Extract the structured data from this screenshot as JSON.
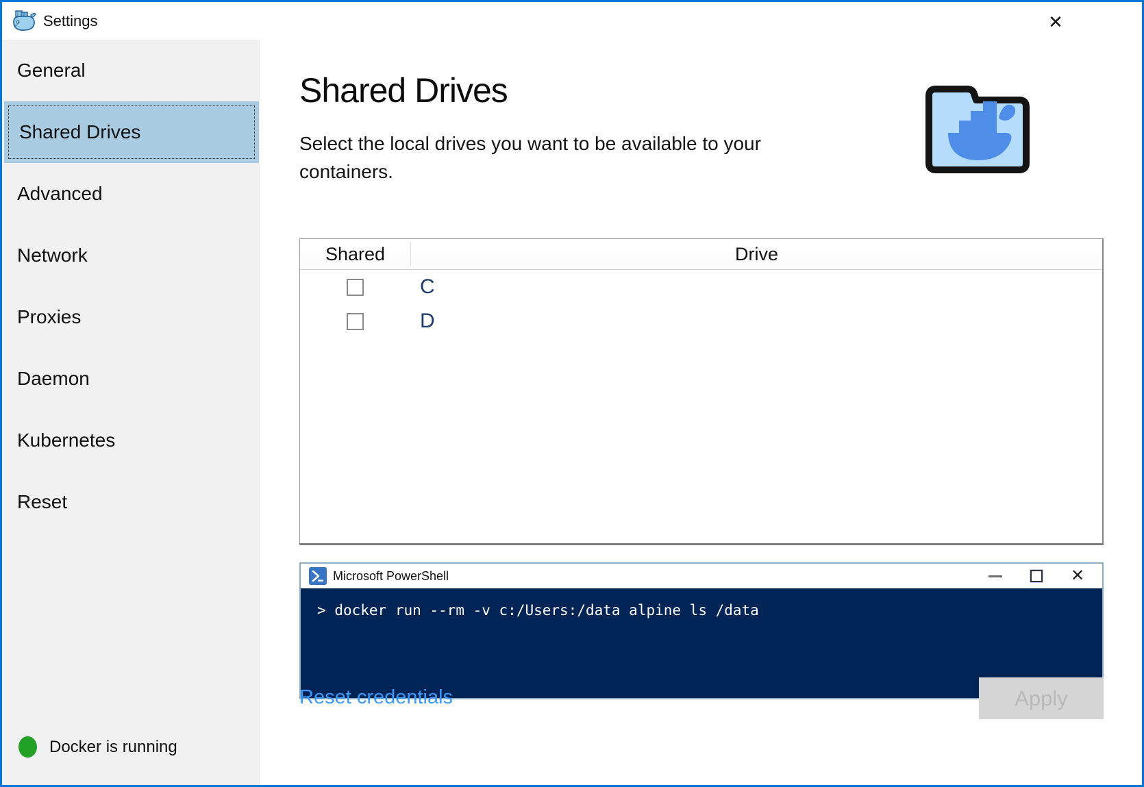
{
  "window": {
    "title": "Settings",
    "close_icon": "✕"
  },
  "sidebar": {
    "items": [
      {
        "label": "General",
        "selected": false
      },
      {
        "label": "Shared Drives",
        "selected": true
      },
      {
        "label": "Advanced",
        "selected": false
      },
      {
        "label": "Network",
        "selected": false
      },
      {
        "label": "Proxies",
        "selected": false
      },
      {
        "label": "Daemon",
        "selected": false
      },
      {
        "label": "Kubernetes",
        "selected": false
      },
      {
        "label": "Reset",
        "selected": false
      }
    ],
    "status": {
      "text": "Docker is running",
      "color": "#23a127"
    }
  },
  "main": {
    "title": "Shared Drives",
    "description": "Select the local drives you want to be available to your containers.",
    "table": {
      "columns": [
        "Shared",
        "Drive"
      ],
      "rows": [
        {
          "shared": false,
          "drive": "C"
        },
        {
          "shared": false,
          "drive": "D"
        }
      ]
    },
    "powershell": {
      "title": "Microsoft PowerShell",
      "prompt": ">",
      "command": "docker run --rm -v c:/Users:/data alpine ls /data"
    },
    "actions": {
      "reset_credentials": "Reset credentials",
      "apply": "Apply",
      "apply_enabled": false
    }
  },
  "colors": {
    "accent_border": "#0078d7",
    "sidebar_bg": "#f1f1f1",
    "selected_bg": "#a9cce3",
    "link_blue": "#3b99fc",
    "terminal_bg": "#012456",
    "drive_letter": "#1b3a6d"
  }
}
